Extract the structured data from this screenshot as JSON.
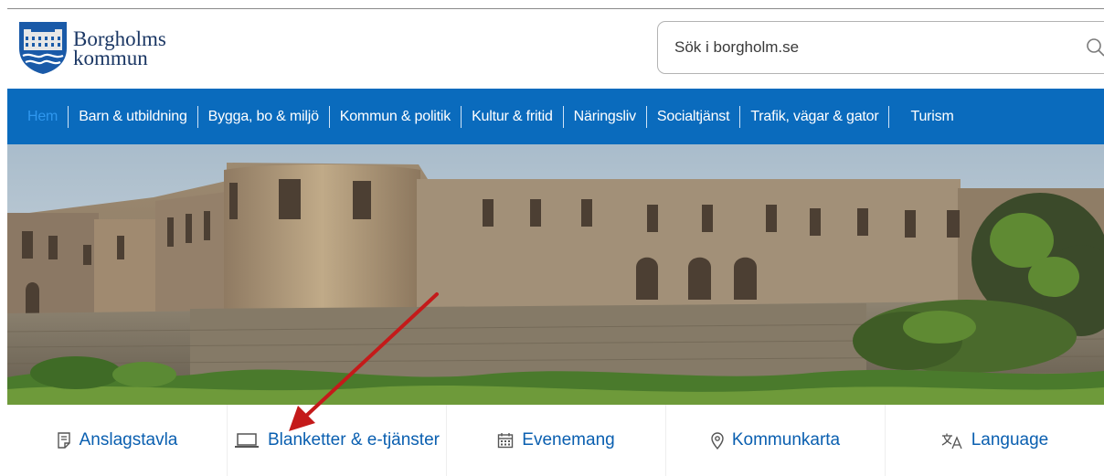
{
  "header": {
    "logo": {
      "line1": "Borgholms",
      "line2": "kommun"
    },
    "search": {
      "placeholder": "Sök i borgholm.se"
    }
  },
  "nav": {
    "items": [
      {
        "label": "Hem",
        "active": true
      },
      {
        "label": "Barn & utbildning"
      },
      {
        "label": "Bygga, bo & miljö"
      },
      {
        "label": "Kommun & politik"
      },
      {
        "label": "Kultur & fritid"
      },
      {
        "label": "Näringsliv"
      },
      {
        "label": "Socialtjänst"
      },
      {
        "label": "Trafik, vägar & gator"
      },
      {
        "label": "Turism"
      }
    ]
  },
  "quicklinks": [
    {
      "label": "Anslagstavla",
      "icon": "notice-board-icon"
    },
    {
      "label": "Blanketter & e-tjänster",
      "icon": "laptop-icon"
    },
    {
      "label": "Evenemang",
      "icon": "calendar-icon"
    },
    {
      "label": "Kommunkarta",
      "icon": "map-pin-icon"
    },
    {
      "label": "Language",
      "icon": "translate-icon"
    }
  ],
  "colors": {
    "nav_bg": "#0a6bbd",
    "link": "#0a5fb0",
    "logo_text": "#1b3764",
    "arrow": "#c41a1a"
  }
}
